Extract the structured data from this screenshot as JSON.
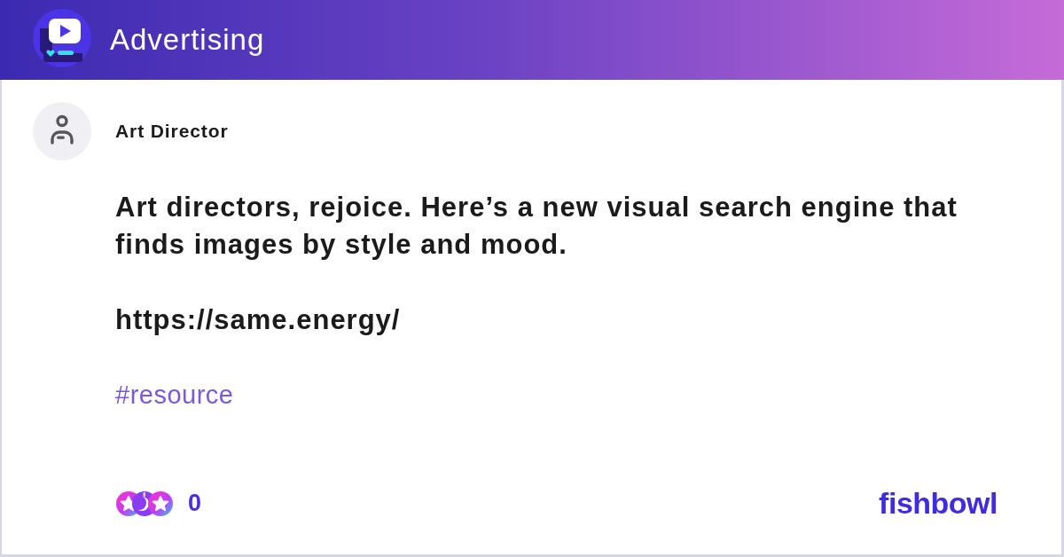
{
  "header": {
    "title": "Advertising"
  },
  "post": {
    "author": "Art Director",
    "body": "Art directors, rejoice. Here’s a new visual search engine that finds images by style and mood.",
    "link": "https://same.energy/",
    "hashtags": [
      "#resource"
    ]
  },
  "footer": {
    "reaction_count": "0",
    "brand": "fishbowl"
  }
}
